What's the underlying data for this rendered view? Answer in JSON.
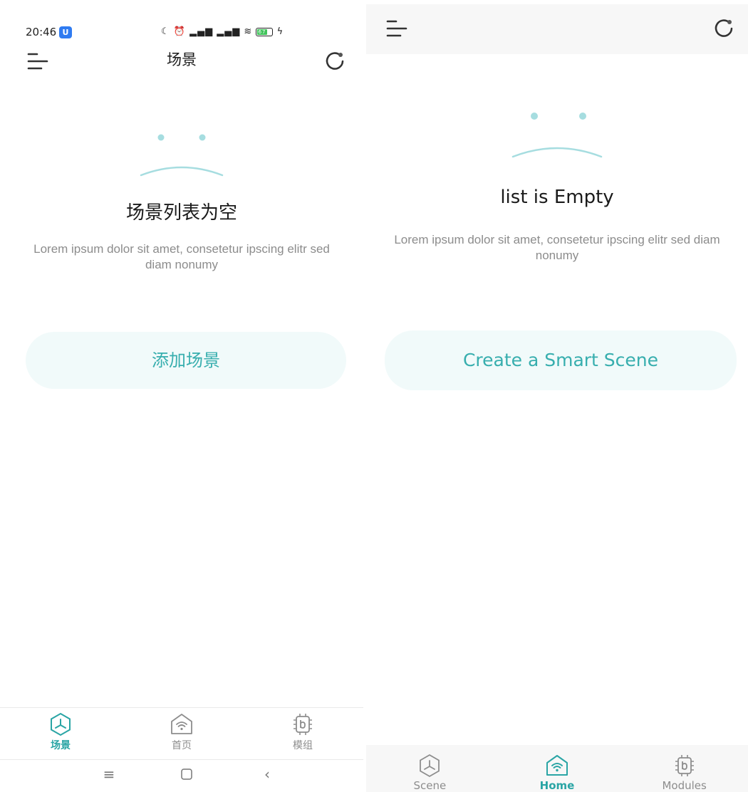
{
  "left": {
    "status": {
      "time": "20:46",
      "app_badge": "U",
      "battery": "67"
    },
    "title": "场景",
    "empty_title": "场景列表为空",
    "empty_desc": "Lorem ipsum dolor sit amet, consetetur ipscing elitr sed diam nonumy",
    "cta_label": "添加场景",
    "nav": [
      {
        "label": "场景",
        "icon": "scene-icon",
        "active": true
      },
      {
        "label": "首页",
        "icon": "home-wifi-icon",
        "active": false
      },
      {
        "label": "模组",
        "icon": "modules-chip-icon",
        "active": false
      }
    ],
    "system_nav": [
      "menu-icon",
      "home-square-icon",
      "back-icon"
    ]
  },
  "right": {
    "empty_title": "list is Empty",
    "empty_desc": "Lorem ipsum dolor sit amet, consetetur ipscing elitr sed diam nonumy",
    "cta_label": "Create a Smart Scene",
    "nav": [
      {
        "label": "Scene",
        "icon": "scene-icon",
        "active": false
      },
      {
        "label": "Home",
        "icon": "home-wifi-icon",
        "active": true
      },
      {
        "label": "Modules",
        "icon": "modules-chip-icon",
        "active": false
      }
    ]
  },
  "colors": {
    "accent": "#37aeae",
    "accent_bold": "#2aa5a5",
    "cta_bg": "#f1fafa",
    "sad_face": "#a6dde0",
    "muted_text": "#8c8c8c"
  }
}
